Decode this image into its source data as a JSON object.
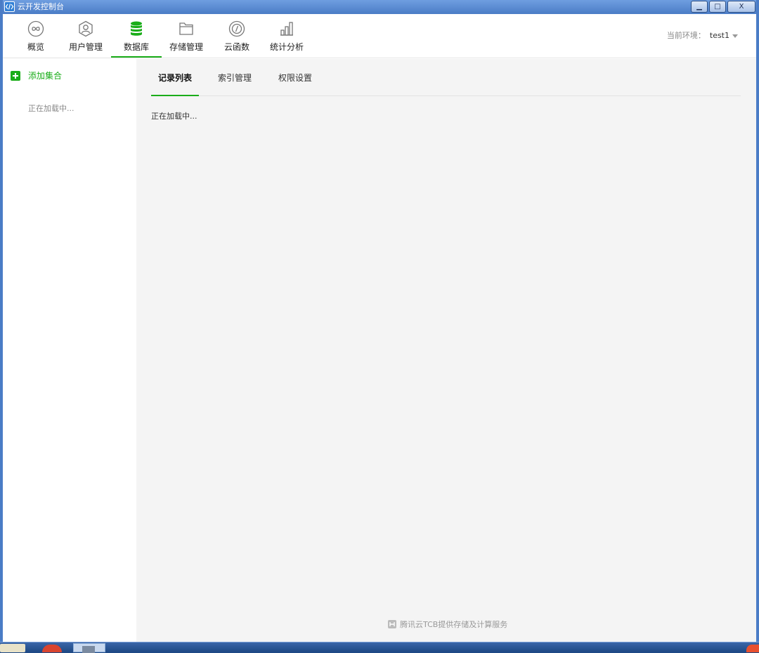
{
  "window": {
    "title": "云开发控制台",
    "controls": {
      "minimize": "▁",
      "maximize": "□",
      "close": "X"
    }
  },
  "nav": {
    "items": [
      {
        "label": "概览",
        "icon": "overview-infinity-icon",
        "active": false
      },
      {
        "label": "用户管理",
        "icon": "user-icon",
        "active": false
      },
      {
        "label": "数据库",
        "icon": "database-icon",
        "active": true
      },
      {
        "label": "存储管理",
        "icon": "folder-icon",
        "active": false
      },
      {
        "label": "云函数",
        "icon": "function-icon",
        "active": false
      },
      {
        "label": "统计分析",
        "icon": "bar-chart-icon",
        "active": false
      }
    ],
    "env_label": "当前环境：",
    "env_value": "test1"
  },
  "sidebar": {
    "add_label": "添加集合",
    "loading": "正在加载中..."
  },
  "main": {
    "tabs": [
      {
        "label": "记录列表",
        "active": true
      },
      {
        "label": "索引管理",
        "active": false
      },
      {
        "label": "权限设置",
        "active": false
      }
    ],
    "loading": "正在加载中...",
    "footer": "腾讯云TCB提供存储及计算服务"
  },
  "colors": {
    "accent": "#1aad19",
    "titlebar": "#4a7cc6",
    "main_bg": "#f4f4f4"
  }
}
